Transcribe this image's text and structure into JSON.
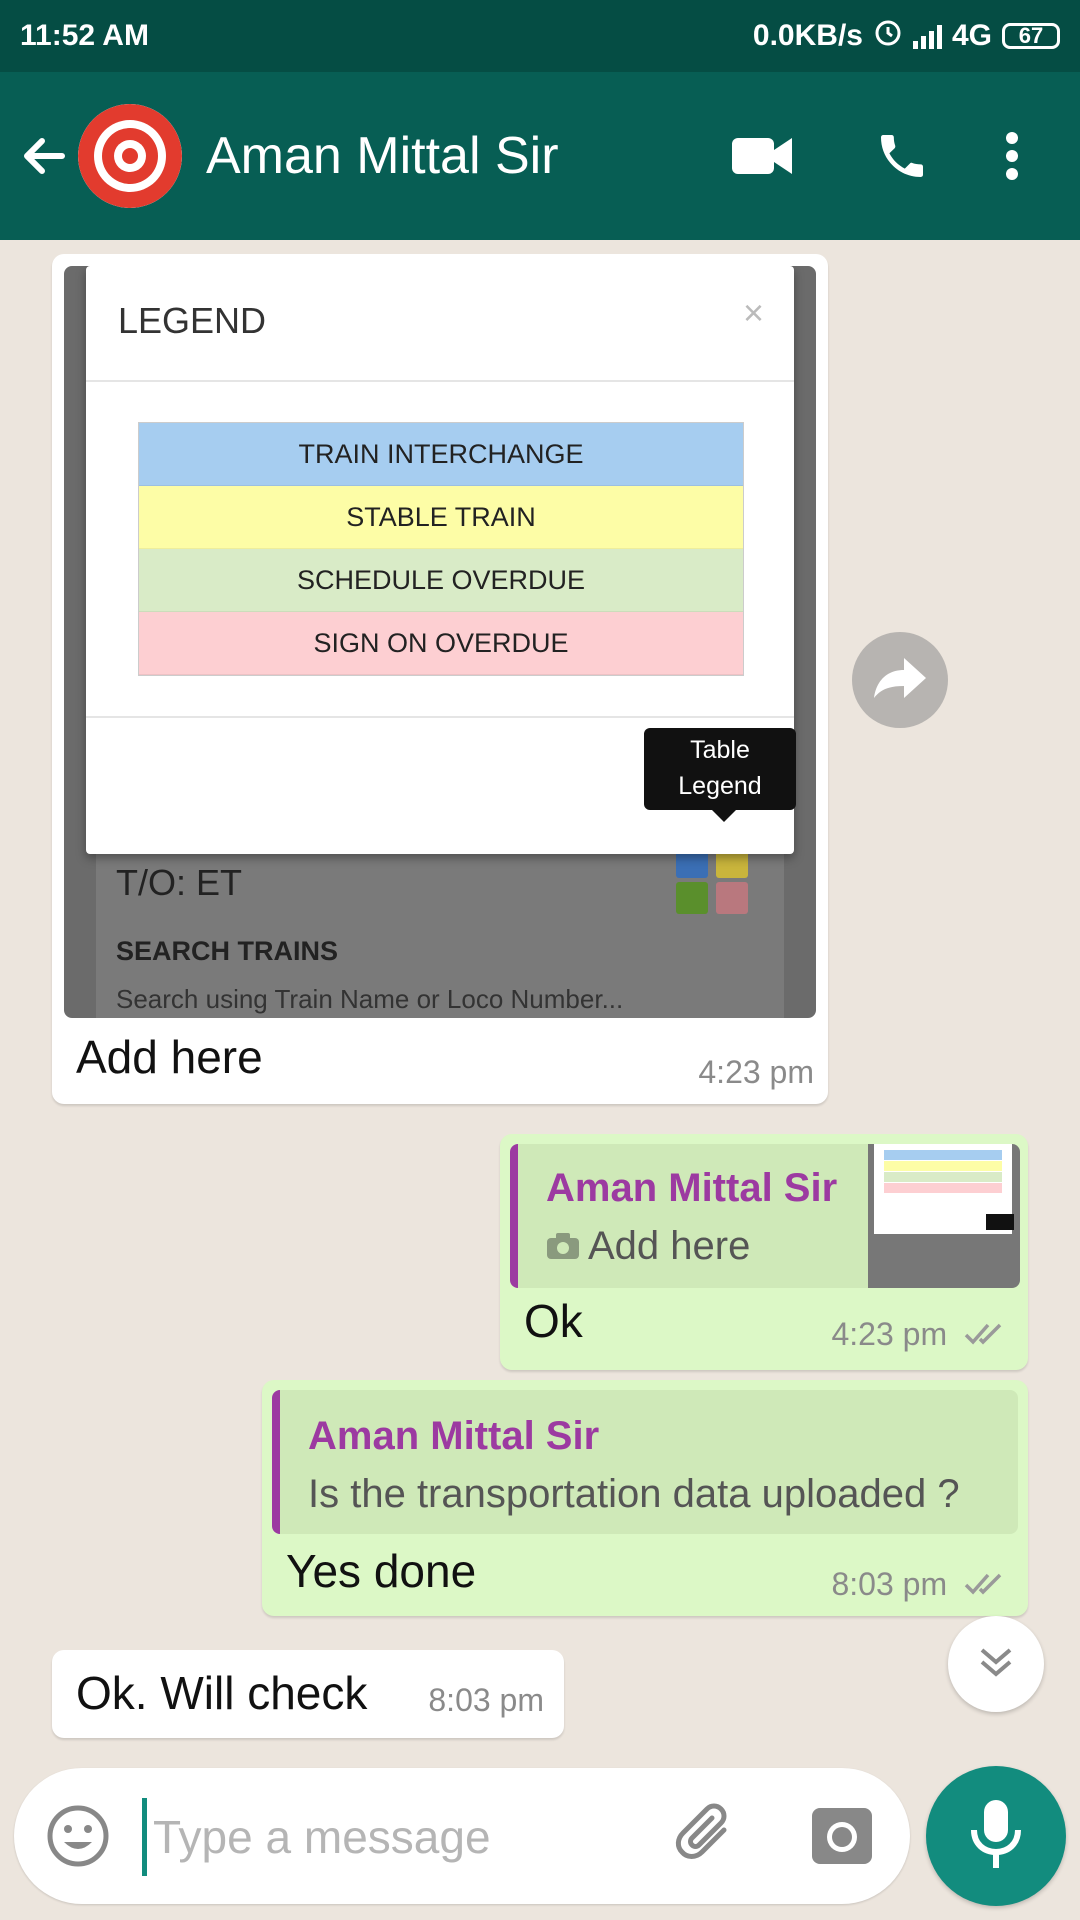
{
  "status_bar": {
    "time": "11:52 AM",
    "speed": "0.0KB/s",
    "network": "4G",
    "battery": "67"
  },
  "header": {
    "back_icon": "arrow-left-icon",
    "contact_name": "Aman Mittal Sir",
    "avatar_icon": "indian-railways-logo",
    "video_icon": "video-camera-icon",
    "call_icon": "phone-icon",
    "menu_icon": "more-vert-icon"
  },
  "messages": {
    "m1": {
      "image": {
        "legend_title": "LEGEND",
        "close": "×",
        "legend_items": [
          {
            "label": "TRAIN INTERCHANGE",
            "color": "#a6cdf0"
          },
          {
            "label": "STABLE TRAIN",
            "color": "#fdfda6"
          },
          {
            "label": "SCHEDULE OVERDUE",
            "color": "#d9ebc7"
          },
          {
            "label": "SIGN ON OVERDUE",
            "color": "#fdcfd2"
          }
        ],
        "tooltip_line1": "Table",
        "tooltip_line2": "Legend",
        "to_label": "T/O: ET",
        "search_label": "SEARCH TRAINS",
        "search_placeholder": "Search using Train Name or Loco Number..."
      },
      "caption": "Add here",
      "time": "4:23 pm"
    },
    "m2": {
      "quote_name": "Aman Mittal Sir",
      "quote_text": "Add here",
      "text": "Ok",
      "time": "4:23 pm"
    },
    "m3": {
      "quote_name": "Aman Mittal Sir",
      "quote_text": "Is the transportation data uploaded ?",
      "text": "Yes done",
      "time": "8:03 pm"
    },
    "m4": {
      "text": "Ok. Will check",
      "time": "8:03 pm"
    }
  },
  "input": {
    "placeholder": "Type a message"
  },
  "colors": {
    "header": "#075e54",
    "status_bar": "#054d44",
    "outgoing": "#dcf8c6",
    "accent": "#128c7e",
    "quote_name": "#9c3aa1"
  }
}
